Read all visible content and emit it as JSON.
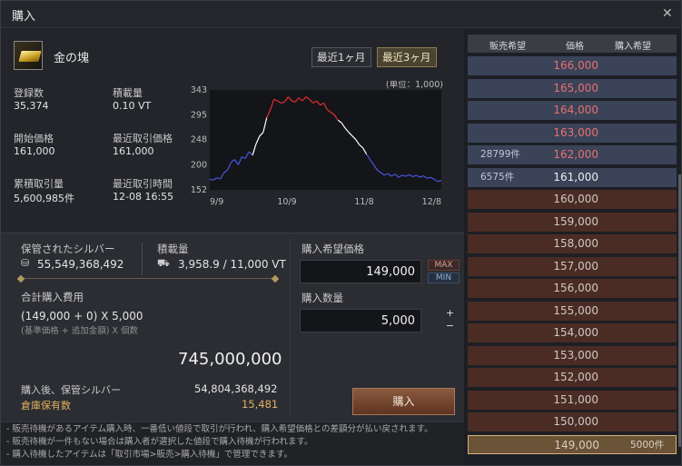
{
  "window": {
    "title": "購入"
  },
  "item": {
    "name": "金の塊"
  },
  "period_buttons": {
    "one_month": "最近1ヶ月",
    "three_months": "最近3ヶ月"
  },
  "stats": {
    "registered_label": "登録数",
    "registered_value": "35,374",
    "weight_label": "積載量",
    "weight_value": "0.10 VT",
    "start_price_label": "開始価格",
    "start_price_value": "161,000",
    "recent_price_label": "最近取引価格",
    "recent_price_value": "161,000",
    "total_trades_label": "累積取引量",
    "total_trades_value": "5,600,985件",
    "recent_time_label": "最近取引時間",
    "recent_time_value": "12-08 16:55"
  },
  "chart_data": {
    "type": "line",
    "unit_note": "(単位：1,000)",
    "yticks": [
      "343",
      "295",
      "248",
      "200",
      "152"
    ],
    "xticks": [
      "9/9",
      "10/9",
      "11/8",
      "12/8"
    ],
    "ylim": [
      152,
      343
    ],
    "series": [
      {
        "values": [
          172,
          171,
          175,
          173,
          185,
          190,
          205,
          210,
          200,
          215,
          212,
          225,
          218,
          240,
          255,
          262,
          290,
          305,
          325,
          322,
          318,
          320,
          330,
          322,
          320,
          328,
          322,
          330,
          325,
          318,
          322,
          314,
          318,
          305,
          300,
          295,
          285,
          280,
          270,
          262,
          255,
          248,
          238,
          232,
          220,
          210,
          200,
          190,
          185,
          180,
          183,
          178,
          182,
          176,
          180,
          178,
          181,
          177,
          180,
          176,
          179,
          174,
          176,
          172,
          168,
          170
        ]
      }
    ],
    "colors": {
      "low": "#4a55e0",
      "mid": "#ffffff",
      "high": "#e03030"
    }
  },
  "purchase": {
    "silver_label": "保管されたシルバー",
    "silver_value": "55,549,368,492",
    "capacity_label": "積載量",
    "capacity_value": "3,958.9 / 11,000 VT",
    "total_cost_label": "合計購入費用",
    "formula": "(149,000 + 0) X 5,000",
    "formula_note": "(基準価格 + 追加金額) X 個数",
    "total_value": "745,000,000",
    "after_label": "購入後、保管シルバー",
    "after_value": "54,804,368,492",
    "storage_label": "倉庫保有数",
    "storage_value": "15,481",
    "price_label": "購入希望価格",
    "price_value": "149,000",
    "qty_label": "購入数量",
    "qty_value": "5,000",
    "max_label": "MAX",
    "min_label": "MIN",
    "plus": "+",
    "minus": "−",
    "buy_label": "購入"
  },
  "notes": [
    "- 販売待機があるアイテム購入時、一番低い値段で取引が行われ、購入希望価格との差額分が払い戻されます。",
    "- 販売待機が一件もない場合は購入者が選択した値段で購入待機が行われます。",
    "- 購入待機したアイテムは「取引市場>販売>購入待機」で管理できます。"
  ],
  "orderbook": {
    "headers": [
      "販売希望",
      "価格",
      "購入希望"
    ],
    "rows": [
      {
        "price": "166,000",
        "count": "",
        "side": "sell"
      },
      {
        "price": "165,000",
        "count": "",
        "side": "sell"
      },
      {
        "price": "164,000",
        "count": "",
        "side": "sell"
      },
      {
        "price": "163,000",
        "count": "",
        "side": "sell"
      },
      {
        "price": "162,000",
        "count": "28799件",
        "side": "sell"
      },
      {
        "price": "161,000",
        "count": "6575件",
        "side": "sell-white"
      },
      {
        "price": "160,000",
        "count": "",
        "side": "buy"
      },
      {
        "price": "159,000",
        "count": "",
        "side": "buy"
      },
      {
        "price": "158,000",
        "count": "",
        "side": "buy"
      },
      {
        "price": "157,000",
        "count": "",
        "side": "buy"
      },
      {
        "price": "156,000",
        "count": "",
        "side": "buy"
      },
      {
        "price": "155,000",
        "count": "",
        "side": "buy"
      },
      {
        "price": "154,000",
        "count": "",
        "side": "buy"
      },
      {
        "price": "153,000",
        "count": "",
        "side": "buy"
      },
      {
        "price": "152,000",
        "count": "",
        "side": "buy"
      },
      {
        "price": "151,000",
        "count": "",
        "side": "buy"
      },
      {
        "price": "150,000",
        "count": "",
        "side": "buy"
      },
      {
        "price": "149,000",
        "count": "5000件",
        "side": "selected"
      }
    ]
  }
}
